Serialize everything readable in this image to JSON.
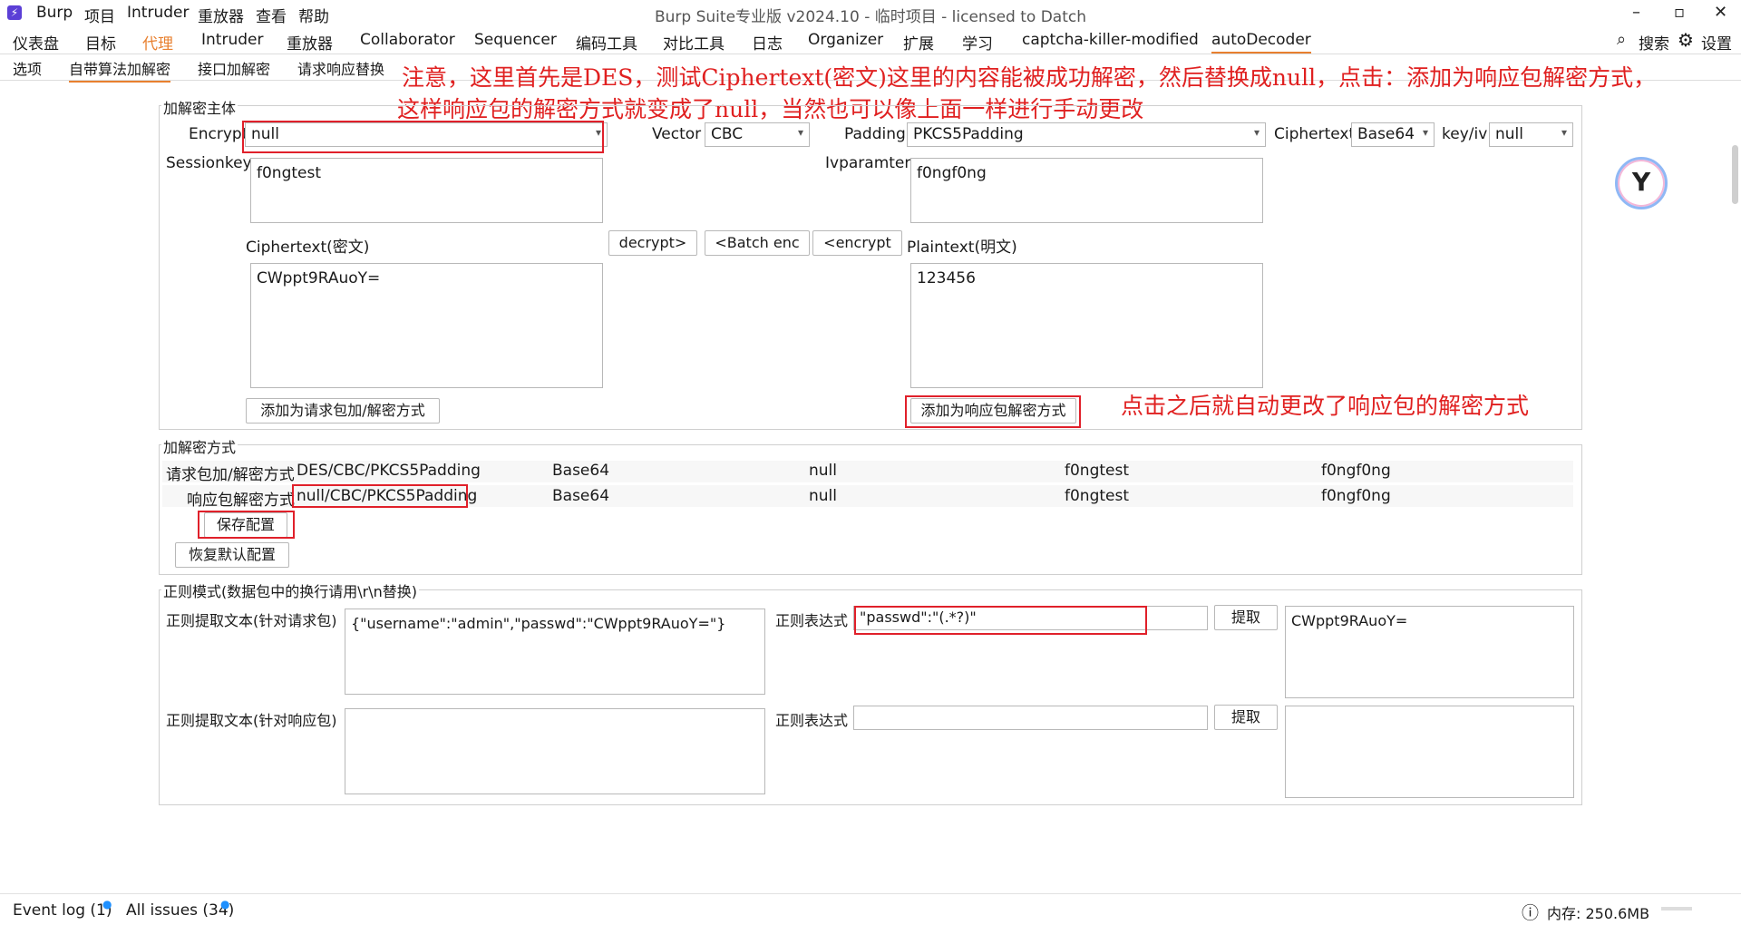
{
  "titlebar": {
    "app_icon": "burp-logo-icon",
    "menus": [
      "Burp",
      "项目",
      "Intruder",
      "重放器",
      "查看",
      "帮助"
    ],
    "window_title": "Burp Suite专业版  v2024.10 - 临时项目 - licensed to Datch",
    "minimize": "–",
    "maximize": "▫",
    "close": "✕"
  },
  "tabs": {
    "items": [
      "仪表盘",
      "目标",
      "代理",
      "Intruder",
      "重放器",
      "Collaborator",
      "Sequencer",
      "编码工具",
      "对比工具",
      "日志",
      "Organizer",
      "扩展",
      "学习",
      "captcha-killer-modified",
      "autoDecoder"
    ],
    "search_label": "搜索",
    "settings_label": "设置"
  },
  "subtabs": {
    "items": [
      "选项",
      "自带算法加解密",
      "接口加解密",
      "请求响应替换"
    ]
  },
  "annotations": {
    "top_line1": "注意，这里首先是DES，测试Ciphertext(密文)这里的内容能被成功解密，然后替换成null，点击：添加为响应包解密方式，",
    "top_line2": "这样响应包的解密方式就变成了null，当然也可以像上面一样进行手动更改",
    "side_note": "点击之后就自动更改了响应包的解密方式"
  },
  "crypto_panel": {
    "title": "加解密主体",
    "encrypt_label": "Encrypt",
    "encrypt_value": "null",
    "vector_label": "Vector",
    "vector_value": "CBC",
    "padding_label": "Padding",
    "padding_value": "PKCS5Padding",
    "ciphertext_format_label": "Ciphertext",
    "ciphertext_format_value": "Base64",
    "keyiv_label": "key/iv",
    "keyiv_value": "null",
    "sessionkey_label": "Sessionkey",
    "sessionkey_value": "f0ngtest",
    "ivparamter_label": "Ivparamter",
    "ivparamter_value": "f0ngf0ng",
    "ciphertext_label": "Ciphertext(密文)",
    "ciphertext_value": "CWppt9RAuoY=",
    "plaintext_label": "Plaintext(明文)",
    "plaintext_value": "123456",
    "decrypt_button": "decrypt>",
    "batch_enc_button": "<Batch enc",
    "encrypt_button": "<encrypt",
    "add_request_button": "添加为请求包加/解密方式",
    "add_response_button": "添加为响应包解密方式"
  },
  "methods_panel": {
    "title": "加解密方式",
    "rows": [
      {
        "label": "请求包加/解密方式",
        "mode": "DES/CBC/PKCS5Padding",
        "format": "Base64",
        "keyiv": "null",
        "key": "f0ngtest",
        "iv": "f0ngf0ng"
      },
      {
        "label": "响应包解密方式",
        "mode": "null/CBC/PKCS5Padding",
        "format": "Base64",
        "keyiv": "null",
        "key": "f0ngtest",
        "iv": "f0ngf0ng"
      }
    ],
    "save_button": "保存配置",
    "restore_button": "恢复默认配置"
  },
  "regex_panel": {
    "title": "正则模式(数据包中的换行请用\\r\\n替换)",
    "req_text_label": "正则提取文本(针对请求包)",
    "req_text_value": "{\"username\":\"admin\",\"passwd\":\"CWppt9RAuoY=\"}",
    "req_regex_label": "正则表达式",
    "req_regex_value": "\"passwd\":\"(.*?)\"",
    "req_extract_button": "提取",
    "req_result": "CWppt9RAuoY=",
    "resp_text_label": "正则提取文本(针对响应包)",
    "resp_text_value": "",
    "resp_regex_label": "正则表达式",
    "resp_regex_value": "",
    "resp_extract_button": "提取",
    "resp_result": ""
  },
  "statusbar": {
    "event_log": "Event log (1)",
    "all_issues": "All issues (34)",
    "memory": "内存: 250.6MB"
  },
  "colors": {
    "accent": "#e8802f",
    "annotation": "#e02020",
    "link_dot": "#1e90ff"
  }
}
